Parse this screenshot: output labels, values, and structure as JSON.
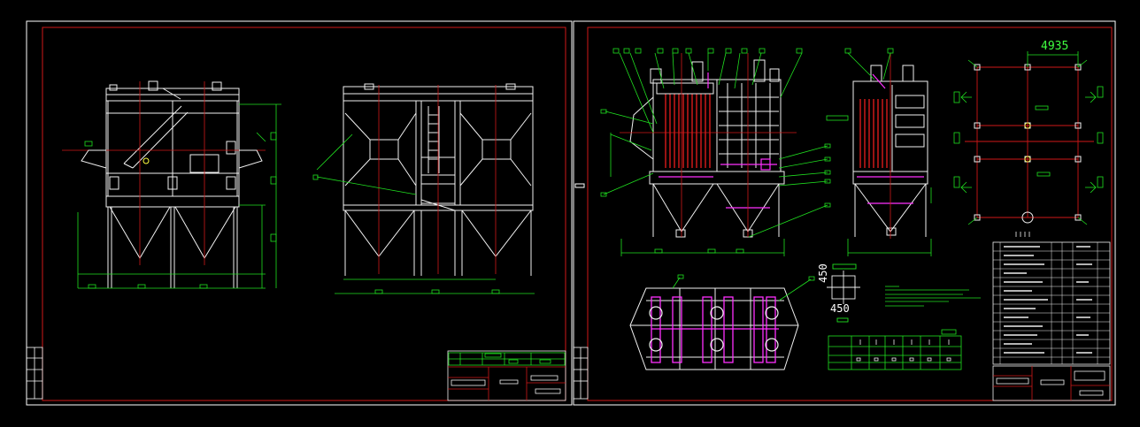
{
  "window": {
    "background": "#000000"
  },
  "colors": {
    "frame_white": "#ffffff",
    "border_red": "#d01818",
    "dim_green": "#20e020",
    "steel_white": "#f0f0f0",
    "bag_red": "#ff2020",
    "pipe_magenta": "#ff30ff",
    "table_green": "#20e020",
    "mark_yellow": "#ffff40"
  },
  "dimensions": {
    "span_top": "4935",
    "flange_a": "450",
    "flange_b": "450"
  }
}
